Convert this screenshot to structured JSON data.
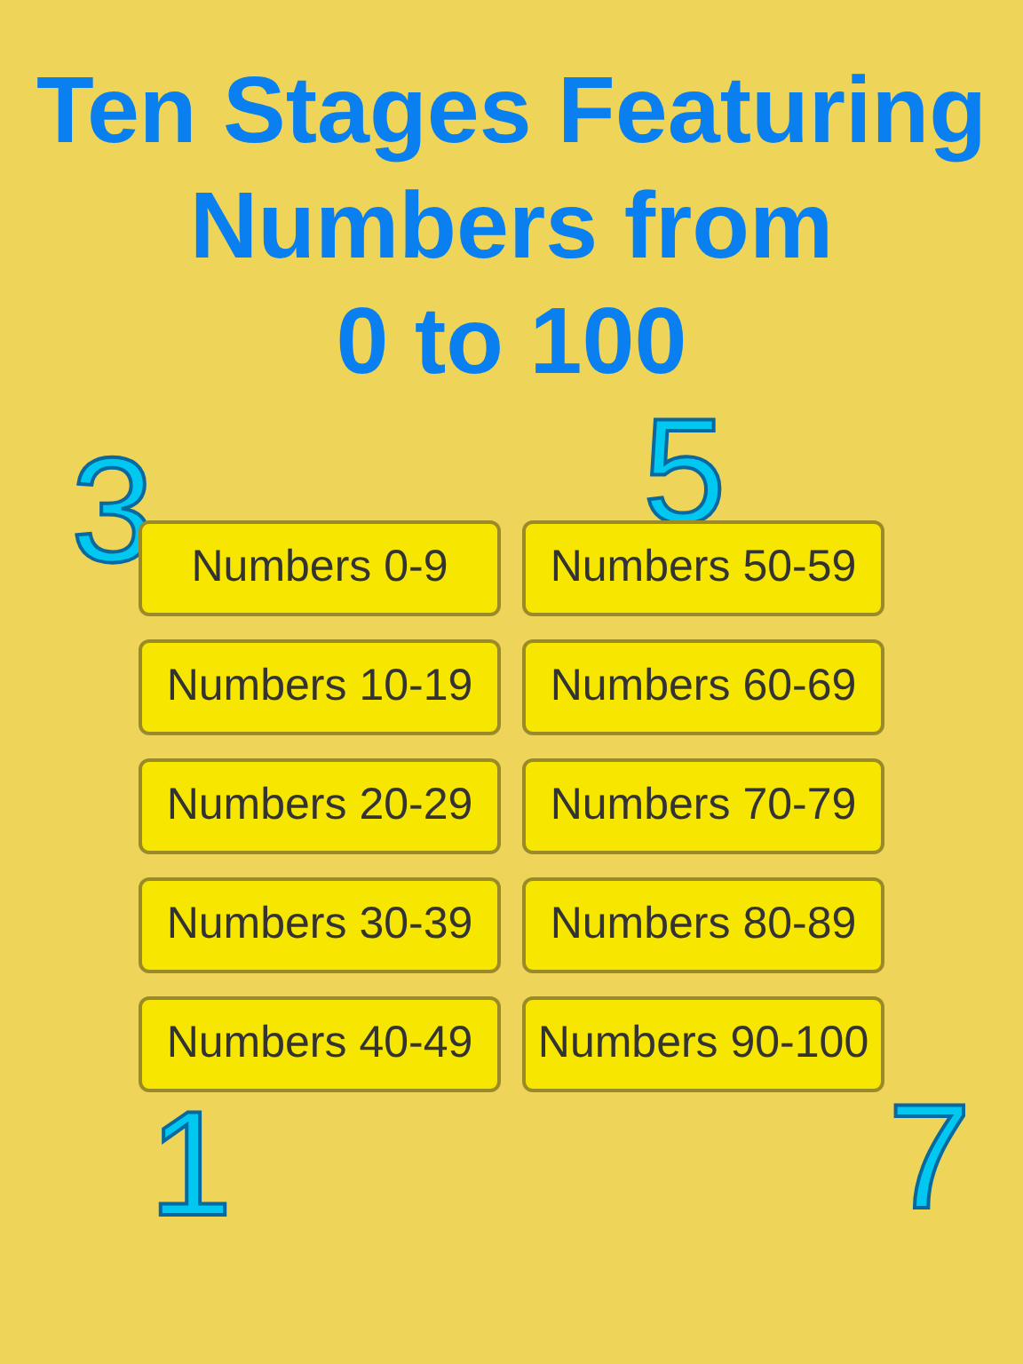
{
  "headline": [
    "Ten Stages Featuring",
    "Numbers from",
    "0 to 100"
  ],
  "background_digits": [
    "3",
    "5",
    "1",
    "7"
  ],
  "stages": [
    {
      "label": "Numbers 0-9"
    },
    {
      "label": "Numbers 50-59"
    },
    {
      "label": "Numbers 10-19"
    },
    {
      "label": "Numbers 60-69"
    },
    {
      "label": "Numbers 20-29"
    },
    {
      "label": "Numbers 70-79"
    },
    {
      "label": "Numbers 30-39"
    },
    {
      "label": "Numbers 80-89"
    },
    {
      "label": "Numbers 40-49"
    },
    {
      "label": "Numbers 90-100"
    }
  ]
}
